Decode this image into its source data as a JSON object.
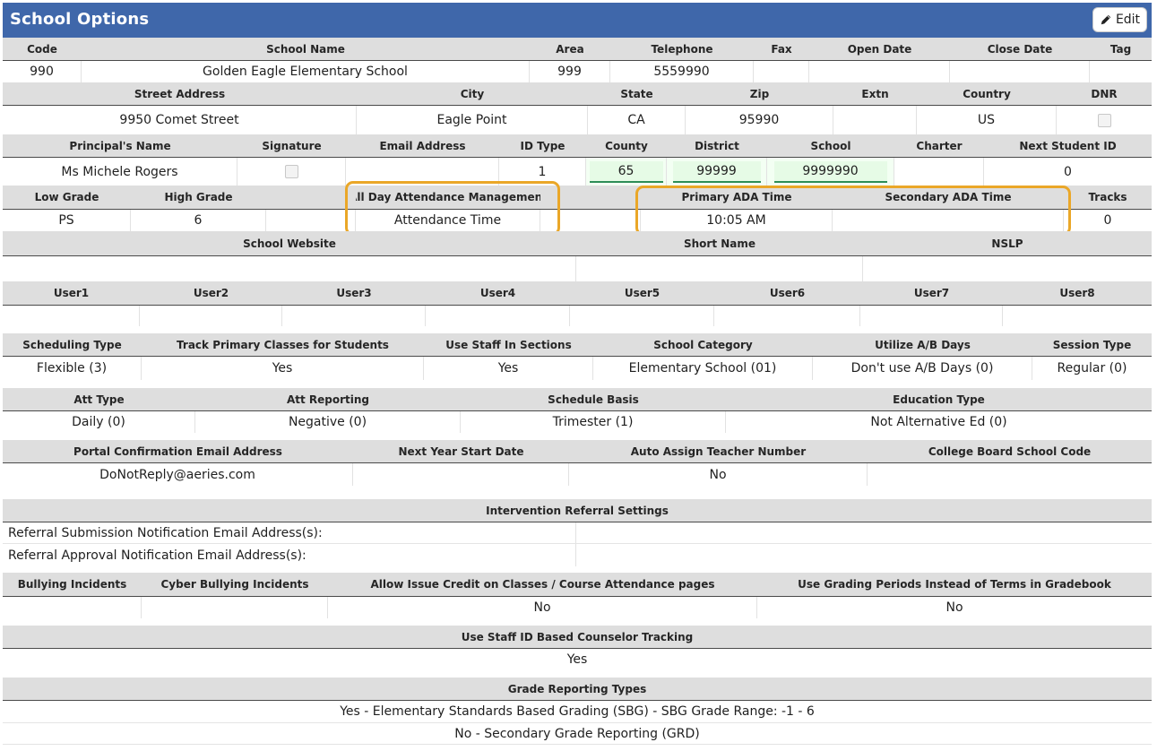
{
  "header": {
    "title": "School Options",
    "edit_label": "Edit"
  },
  "sec1": {
    "headers": [
      "Code",
      "School Name",
      "Area",
      "Telephone",
      "Fax",
      "Open Date",
      "Close Date",
      "Tag"
    ],
    "values": [
      "990",
      "Golden Eagle Elementary School",
      "999",
      "5559990",
      "",
      "",
      "",
      ""
    ]
  },
  "sec2": {
    "headers": [
      "Street Address",
      "City",
      "State",
      "Zip",
      "Extn",
      "Country",
      "DNR"
    ],
    "values": [
      "9950 Comet Street",
      "Eagle Point",
      "CA",
      "95990",
      "",
      "US",
      ""
    ]
  },
  "sec3": {
    "headers": [
      "Principal's Name",
      "Signature",
      "Email Address",
      "ID Type",
      "County",
      "District",
      "School",
      "Charter",
      "Next Student ID"
    ],
    "values": [
      "Ms Michele Rogers",
      "",
      "",
      "1",
      "65",
      "99999",
      "9999990",
      "",
      "0"
    ]
  },
  "sec4": {
    "headers": [
      "Low Grade",
      "High Grade",
      "",
      "All Day Attendance Management",
      "",
      "Primary ADA Time",
      "Secondary ADA Time",
      "Tracks"
    ],
    "values": [
      "PS",
      "6",
      "",
      "Attendance Time",
      "",
      "10:05 AM",
      "",
      "0"
    ]
  },
  "sec5": {
    "headers": [
      "School Website",
      "Short Name",
      "NSLP"
    ],
    "values": [
      "",
      "",
      ""
    ]
  },
  "sec6": {
    "headers": [
      "User1",
      "User2",
      "User3",
      "User4",
      "User5",
      "User6",
      "User7",
      "User8"
    ],
    "values": [
      "",
      "",
      "",
      "",
      "",
      "",
      "",
      ""
    ]
  },
  "sec7": {
    "headers": [
      "Scheduling Type",
      "Track Primary Classes for Students",
      "Use Staff In Sections",
      "School Category",
      "Utilize A/B Days",
      "Session Type"
    ],
    "values": [
      "Flexible (3)",
      "Yes",
      "Yes",
      "Elementary School (01)",
      "Don't use A/B Days (0)",
      "Regular (0)"
    ]
  },
  "sec8": {
    "headers": [
      "Att Type",
      "Att Reporting",
      "Schedule Basis",
      "Education Type"
    ],
    "values": [
      "Daily (0)",
      "Negative (0)",
      "Trimester (1)",
      "Not Alternative Ed (0)"
    ]
  },
  "sec9": {
    "headers": [
      "Portal Confirmation Email Address",
      "Next Year Start Date",
      "Auto Assign Teacher Number",
      "College Board School Code"
    ],
    "values": [
      "DoNotReply@aeries.com",
      "",
      "No",
      ""
    ]
  },
  "sec10": {
    "header": "Intervention Referral Settings",
    "rows": [
      {
        "label": "Referral Submission Notification Email Address(s):",
        "value": ""
      },
      {
        "label": "Referral Approval Notification Email Address(s):",
        "value": ""
      }
    ]
  },
  "sec11": {
    "headers": [
      "Bullying Incidents",
      "Cyber Bullying Incidents",
      "Allow Issue Credit on Classes / Course Attendance pages",
      "Use Grading Periods Instead of Terms in Gradebook"
    ],
    "values": [
      "",
      "",
      "No",
      "No"
    ]
  },
  "sec12": {
    "header": "Use Staff ID Based Counselor Tracking",
    "value": "Yes"
  },
  "sec13": {
    "header": "Grade Reporting Types",
    "rows": [
      "Yes - Elementary Standards Based Grading (SBG) - SBG Grade Range: -1 - 6",
      "No - Secondary Grade Reporting (GRD)"
    ]
  },
  "colors": {
    "title_bar": "#3f67aa",
    "highlight": "#eaa728",
    "header_band": "#dedede",
    "input_green": "#e6fbe6"
  }
}
